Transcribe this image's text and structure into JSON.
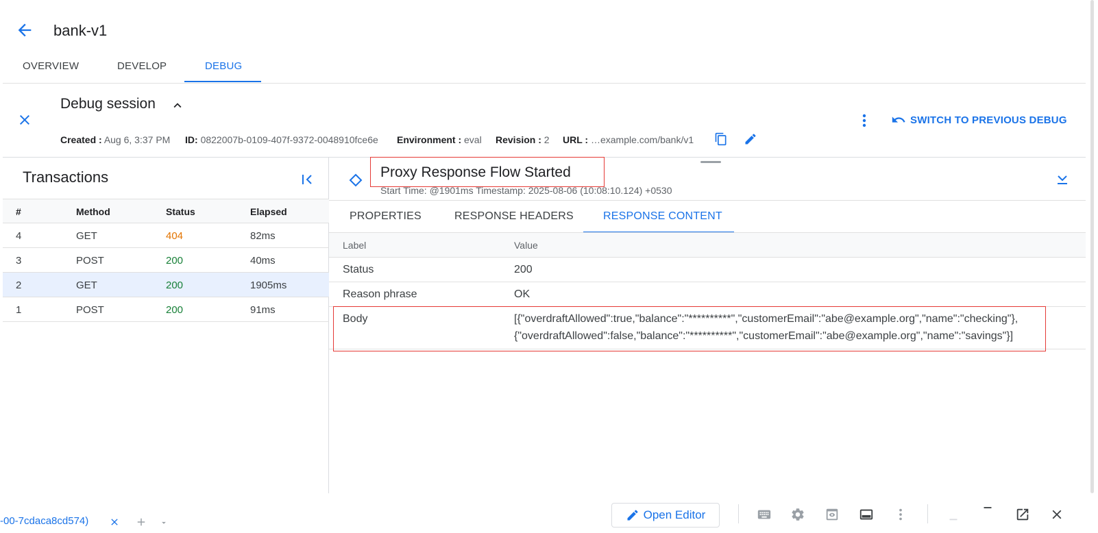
{
  "header": {
    "title": "bank-v1",
    "tabs": [
      {
        "label": "OVERVIEW"
      },
      {
        "label": "DEVELOP"
      },
      {
        "label": "DEBUG"
      }
    ]
  },
  "session": {
    "title": "Debug session",
    "created_label": "Created :",
    "created_value": "Aug 6, 3:37 PM",
    "id_label": "ID:",
    "id_value": "0822007b-0109-407f-9372-0048910fce6e",
    "environment_label": "Environment :",
    "environment_value": "eval",
    "revision_label": "Revision :",
    "revision_value": "2",
    "url_label": "URL :",
    "url_value": "…example.com/bank/v1",
    "switch_label": "SWITCH TO PREVIOUS DEBUG"
  },
  "transactions": {
    "title": "Transactions",
    "columns": [
      "#",
      "Method",
      "Status",
      "Elapsed"
    ],
    "rows": [
      {
        "num": "4",
        "method": "GET",
        "status": "404",
        "elapsed": "82ms"
      },
      {
        "num": "3",
        "method": "POST",
        "status": "200",
        "elapsed": "40ms"
      },
      {
        "num": "2",
        "method": "GET",
        "status": "200",
        "elapsed": "1905ms"
      },
      {
        "num": "1",
        "method": "POST",
        "status": "200",
        "elapsed": "91ms"
      }
    ],
    "selected_num": "2"
  },
  "detail": {
    "step_title": "Proxy Response Flow Started",
    "step_time": "Start Time: @1901ms Timestamp: 2025-08-06 (10:08:10.124) +0530",
    "tabs": [
      {
        "label": "PROPERTIES"
      },
      {
        "label": "RESPONSE HEADERS"
      },
      {
        "label": "RESPONSE CONTENT"
      }
    ],
    "columns": [
      "Label",
      "Value"
    ],
    "rows": [
      {
        "label": "Status",
        "value": "200"
      },
      {
        "label": "Reason phrase",
        "value": "OK"
      },
      {
        "label": "Body",
        "value_line1": "[{\"overdraftAllowed\":true,\"balance\":\"**********\",\"customerEmail\":\"abe@example.org\",\"name\":\"checking\"},",
        "value_line2": "{\"overdraftAllowed\":false,\"balance\":\"**********\",\"customerEmail\":\"abe@example.org\",\"name\":\"savings\"}]"
      }
    ]
  },
  "bottom_bar": {
    "tab_label": "-00-7cdaca8cd574)",
    "open_editor_label": "Open Editor"
  },
  "colors": {
    "accent": "#1a73e8",
    "ok": "#188038",
    "warn": "#e37400",
    "highlight_box": "#e53935"
  }
}
